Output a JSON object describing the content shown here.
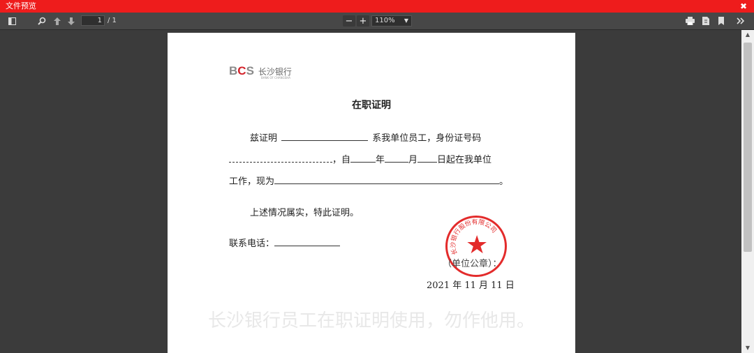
{
  "window": {
    "title": "文件预览",
    "close_label": "✖"
  },
  "toolbar": {
    "page_current": "1",
    "page_total": "/ 1",
    "zoom": "110%",
    "zoom_out": "−",
    "zoom_in": "+"
  },
  "document": {
    "logo_mark_b": "B",
    "logo_mark_c": "C",
    "logo_mark_s": "S",
    "logo_cn": "长沙银行",
    "logo_en": "BANK OF CHANGSHA",
    "title": "在职证明",
    "line1_prefix": "兹证明",
    "line1_suffix": "系我单位员工，身份证号码",
    "line2_from": "，自",
    "line2_year": "年",
    "line2_month": "月",
    "line2_day": "日起在我单位",
    "line3_prefix": "工作，现为",
    "line3_suffix": "。",
    "line4": "上述情况属实，特此证明。",
    "phone_label": "联系电话：",
    "seal_label": "（单位公章）：",
    "seal_text": "长沙银行股份有限公司",
    "date": "2021 年 11 月 11 日",
    "watermark": "长沙银行员工在职证明使用，勿作他用。"
  }
}
